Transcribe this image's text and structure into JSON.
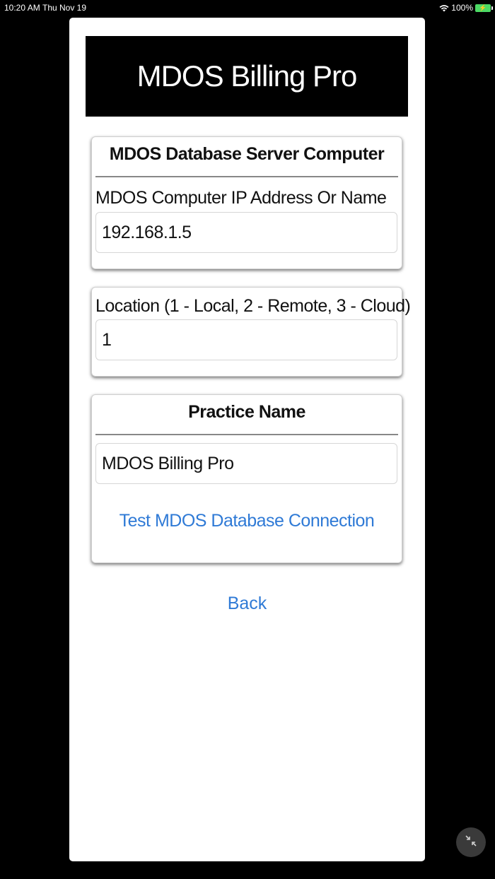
{
  "status_bar": {
    "time": "10:20 AM",
    "date": "Thu Nov 19",
    "battery": "100%",
    "wifi_icon": "wifi-icon",
    "battery_icon": "battery-charging-icon"
  },
  "app": {
    "title": "MDOS Billing Pro"
  },
  "server_card": {
    "title": "MDOS Database Server Computer",
    "ip_label": "MDOS Computer IP Address Or Name",
    "ip_value": "192.168.1.5"
  },
  "location_card": {
    "label": "Location (1 - Local, 2 - Remote, 3 - Cloud)",
    "value": "1"
  },
  "practice_card": {
    "title": "Practice Name",
    "value": "MDOS Billing Pro",
    "test_button": "Test MDOS Database Connection"
  },
  "back_button": "Back",
  "colors": {
    "link": "#2f7ad6",
    "banner_bg": "#000000",
    "battery": "#4cd964"
  },
  "fullscreen_icon": "collapse-arrows-icon"
}
